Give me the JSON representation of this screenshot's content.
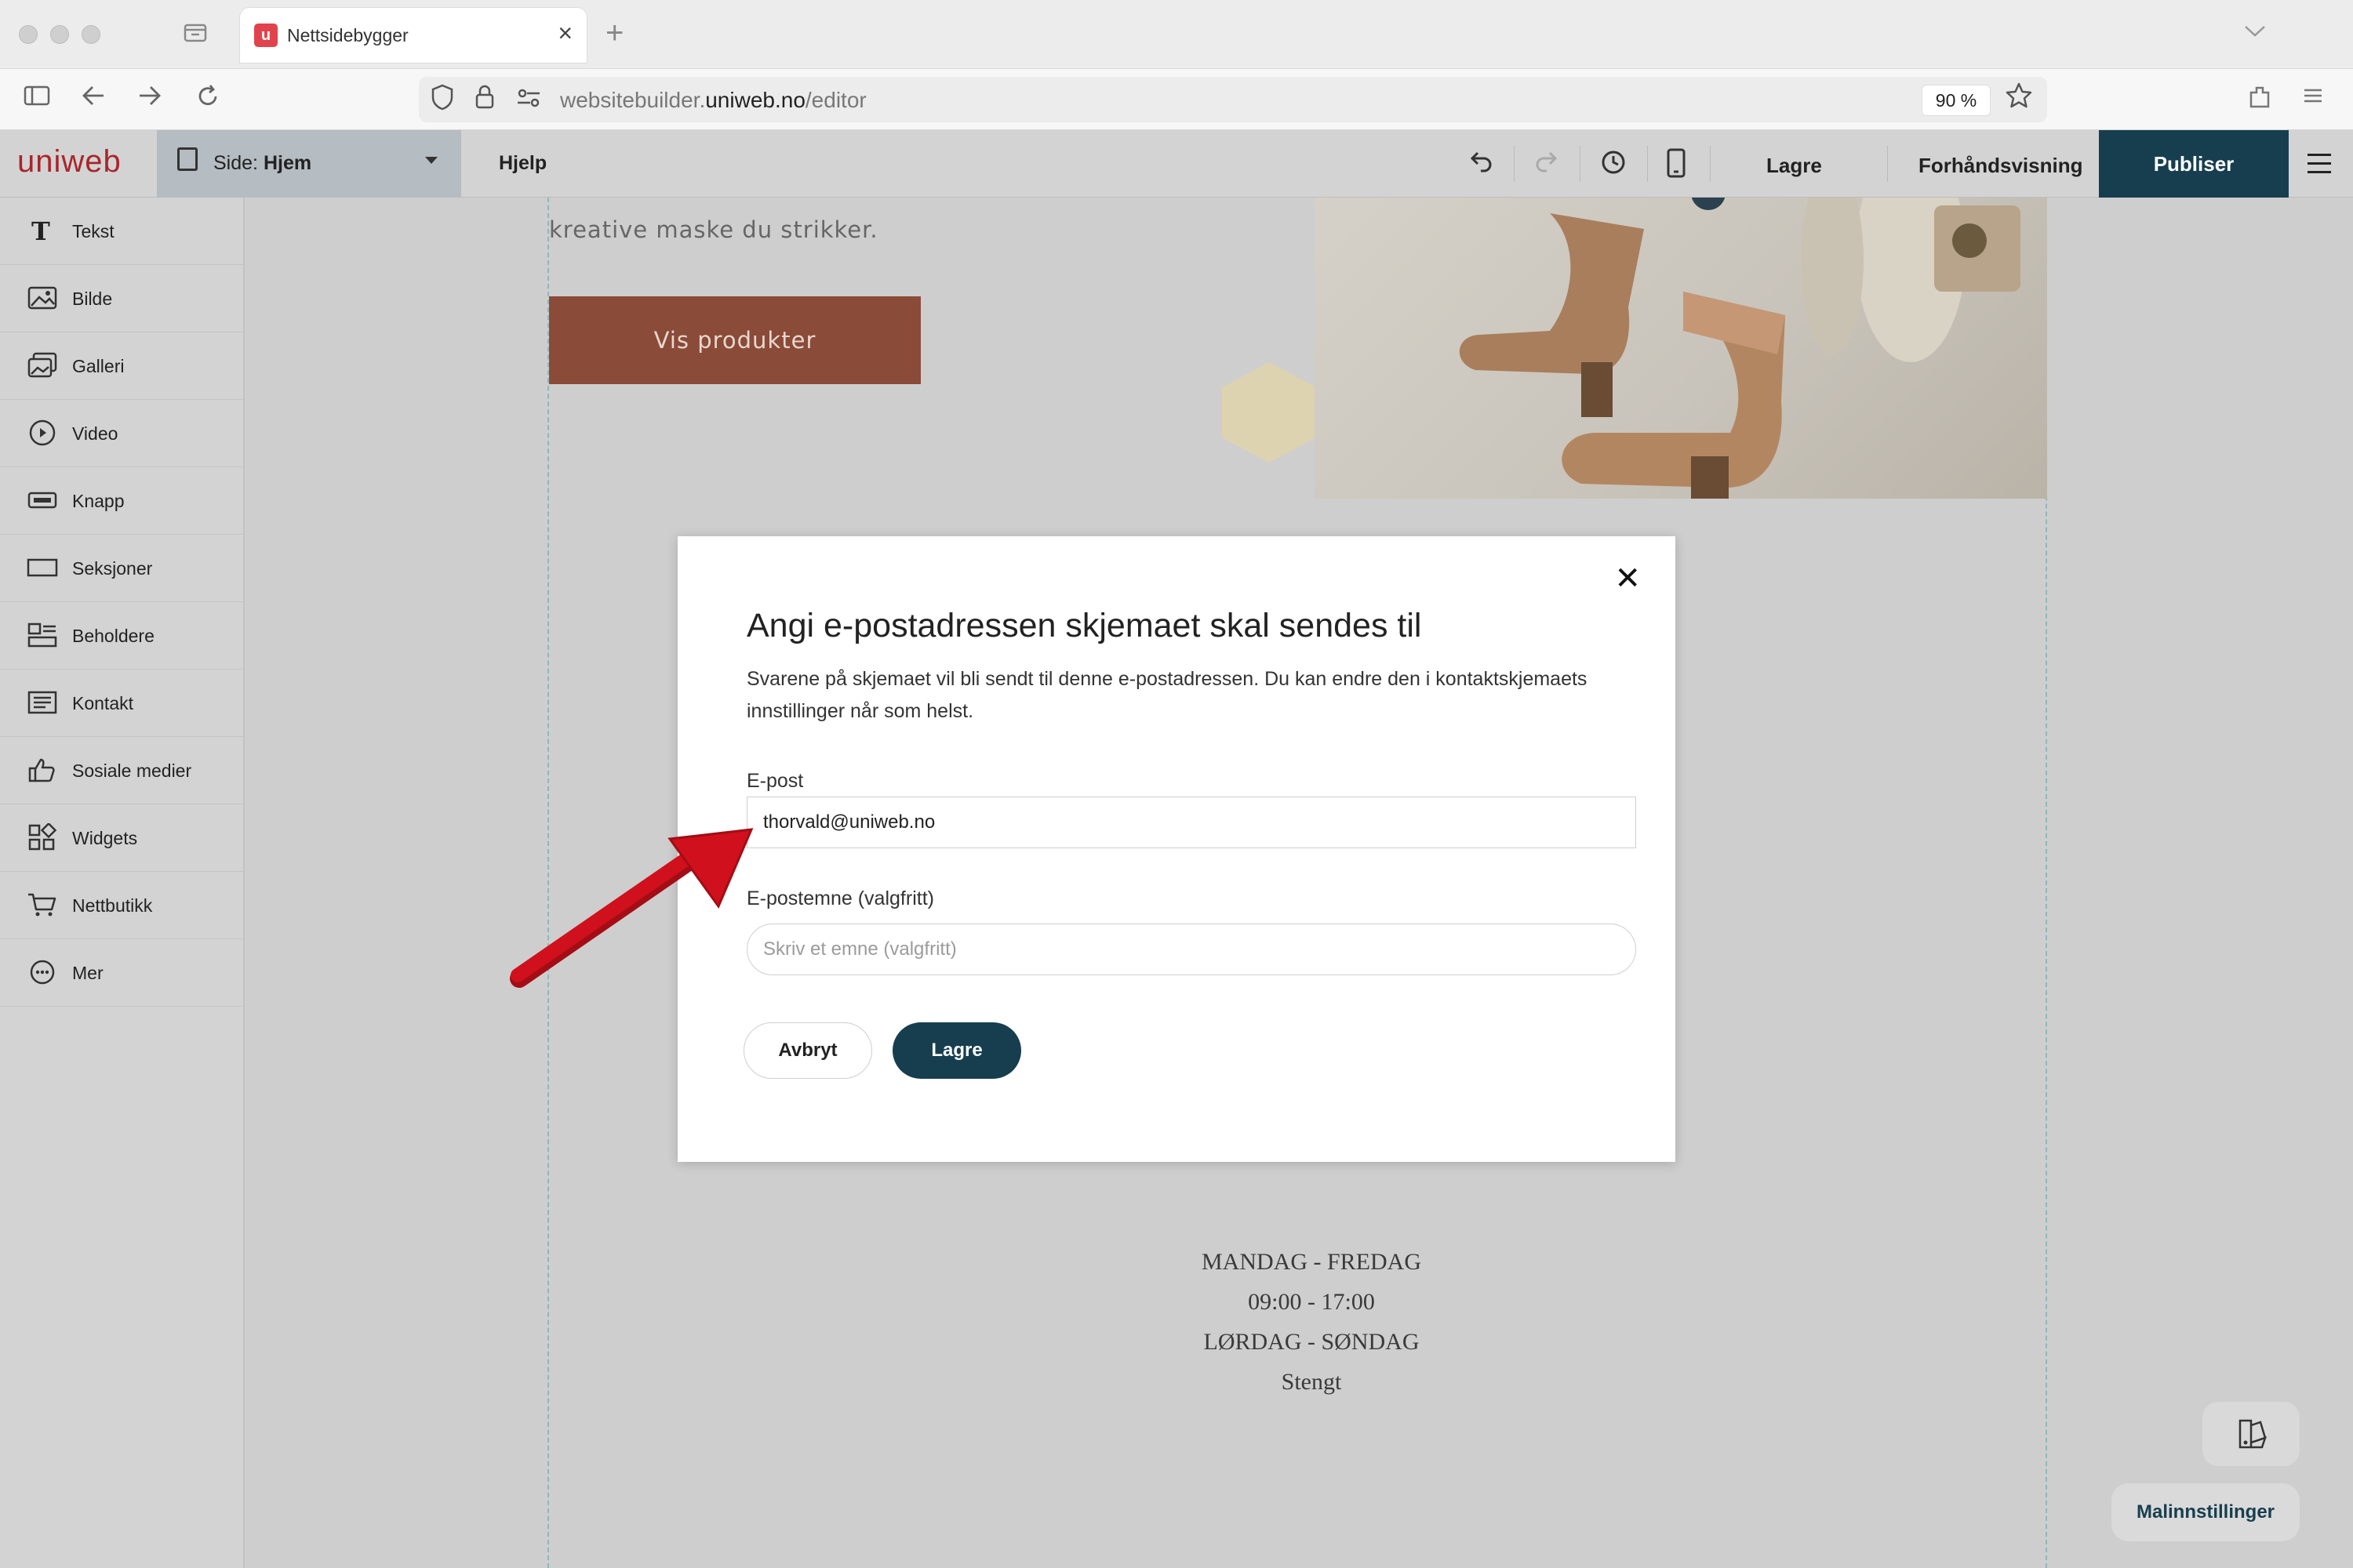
{
  "browser": {
    "tab_title": "Nettsidebygger",
    "tab_favicon_letter": "u",
    "url_prefix": "websitebuilder.",
    "url_domain": "uniweb.no",
    "url_path": "/editor",
    "zoom": "90 %"
  },
  "editor": {
    "logo": "uniweb",
    "page_label_prefix": "Side: ",
    "page_label_name": "Hjem",
    "help": "Hjelp",
    "save": "Lagre",
    "preview": "Forhåndsvisning",
    "publish": "Publiser"
  },
  "sidebar": {
    "items": [
      {
        "label": "Tekst",
        "icon": "text-icon"
      },
      {
        "label": "Bilde",
        "icon": "image-icon"
      },
      {
        "label": "Galleri",
        "icon": "gallery-icon"
      },
      {
        "label": "Video",
        "icon": "video-icon"
      },
      {
        "label": "Knapp",
        "icon": "button-icon"
      },
      {
        "label": "Seksjoner",
        "icon": "sections-icon"
      },
      {
        "label": "Beholdere",
        "icon": "containers-icon"
      },
      {
        "label": "Kontakt",
        "icon": "contact-icon"
      },
      {
        "label": "Sosiale medier",
        "icon": "thumbs-up-icon"
      },
      {
        "label": "Widgets",
        "icon": "widgets-icon"
      },
      {
        "label": "Nettbutikk",
        "icon": "cart-icon"
      },
      {
        "label": "Mer",
        "icon": "more-icon"
      }
    ]
  },
  "canvas": {
    "hero_text": "kreative maske du strikker.",
    "cta_label": "Vis produkter",
    "hours": [
      "MANDAG - FREDAG",
      "09:00 - 17:00",
      "LØRDAG - SØNDAG",
      "Stengt"
    ],
    "template_settings": "Malinnstillinger"
  },
  "modal": {
    "title": "Angi e-postadressen skjemaet skal sendes til",
    "description": "Svarene på skjemaet vil bli sendt til denne e-postadressen. Du kan endre den i kontaktskjemaets innstillinger når som helst.",
    "email_label": "E-post",
    "email_value": "thorvald@uniweb.no",
    "subject_label": "E-postemne (valgfritt)",
    "subject_placeholder": "Skriv et emne (valgfritt)",
    "cancel": "Avbryt",
    "save": "Lagre"
  },
  "colors": {
    "brand": "#a8262c",
    "primary_button": "#173e4f",
    "cta": "#8a4b38",
    "arrow": "#d0101c"
  }
}
